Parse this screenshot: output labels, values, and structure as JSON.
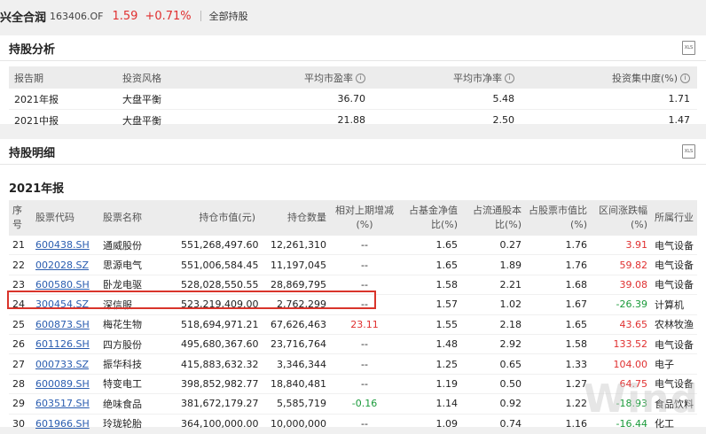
{
  "header": {
    "fund_name": "兴全合润",
    "fund_code": "163406.OF",
    "price": "1.59",
    "change": "+0.71%",
    "all_holdings": "全部持股"
  },
  "analysis": {
    "title": "持股分析",
    "export_icon": "xls-export-icon",
    "columns": [
      "报告期",
      "投资风格",
      "平均市盈率",
      "平均市净率",
      "投资集中度(%)"
    ],
    "rows": [
      [
        "2021年报",
        "大盘平衡",
        "36.70",
        "5.48",
        "1.71"
      ],
      [
        "2021中报",
        "大盘平衡",
        "21.88",
        "2.50",
        "1.47"
      ]
    ]
  },
  "detail": {
    "title": "持股明细",
    "export_icon": "xls-export-icon",
    "year": "2021年报",
    "columns": [
      "序号",
      "股票代码",
      "股票名称",
      "持仓市值(元)",
      "持仓数量",
      "相对上期增减(%)",
      "占基金净值比(%)",
      "占流通股本比(%)",
      "占股票市值比(%)",
      "区间涨跌幅(%)",
      "所属行业"
    ],
    "rows": [
      {
        "no": "21",
        "code": "600438.SH",
        "name": "通威股份",
        "value": "551,268,497.60",
        "qty": "12,261,310",
        "chg": "--",
        "nav": "1.65",
        "float": "0.27",
        "mkt": "1.76",
        "ret": "3.91",
        "industry": "电气设备"
      },
      {
        "no": "22",
        "code": "002028.SZ",
        "name": "思源电气",
        "value": "551,006,584.45",
        "qty": "11,197,045",
        "chg": "--",
        "nav": "1.65",
        "float": "1.89",
        "mkt": "1.76",
        "ret": "59.82",
        "industry": "电气设备"
      },
      {
        "no": "23",
        "code": "600580.SH",
        "name": "卧龙电驱",
        "value": "528,028,550.55",
        "qty": "28,869,795",
        "chg": "--",
        "nav": "1.58",
        "float": "2.21",
        "mkt": "1.68",
        "ret": "39.08",
        "industry": "电气设备"
      },
      {
        "no": "24",
        "code": "300454.SZ",
        "name": "深信服",
        "value": "523,219,409.00",
        "qty": "2,762,299",
        "chg": "--",
        "nav": "1.57",
        "float": "1.02",
        "mkt": "1.67",
        "ret": "-26.39",
        "industry": "计算机"
      },
      {
        "no": "25",
        "code": "600873.SH",
        "name": "梅花生物",
        "value": "518,694,971.21",
        "qty": "67,626,463",
        "chg": "23.11",
        "nav": "1.55",
        "float": "2.18",
        "mkt": "1.65",
        "ret": "43.65",
        "industry": "农林牧渔"
      },
      {
        "no": "26",
        "code": "601126.SH",
        "name": "四方股份",
        "value": "495,680,367.60",
        "qty": "23,716,764",
        "chg": "--",
        "nav": "1.48",
        "float": "2.92",
        "mkt": "1.58",
        "ret": "133.52",
        "industry": "电气设备"
      },
      {
        "no": "27",
        "code": "000733.SZ",
        "name": "振华科技",
        "value": "415,883,632.32",
        "qty": "3,346,344",
        "chg": "--",
        "nav": "1.25",
        "float": "0.65",
        "mkt": "1.33",
        "ret": "104.00",
        "industry": "电子"
      },
      {
        "no": "28",
        "code": "600089.SH",
        "name": "特变电工",
        "value": "398,852,982.77",
        "qty": "18,840,481",
        "chg": "--",
        "nav": "1.19",
        "float": "0.50",
        "mkt": "1.27",
        "ret": "64.75",
        "industry": "电气设备"
      },
      {
        "no": "29",
        "code": "603517.SH",
        "name": "绝味食品",
        "value": "381,672,179.27",
        "qty": "5,585,719",
        "chg": "-0.16",
        "nav": "1.14",
        "float": "0.92",
        "mkt": "1.22",
        "ret": "-18.93",
        "industry": "食品饮料"
      },
      {
        "no": "30",
        "code": "601966.SH",
        "name": "玲珑轮胎",
        "value": "364,100,000.00",
        "qty": "10,000,000",
        "chg": "--",
        "nav": "1.09",
        "float": "0.74",
        "mkt": "1.16",
        "ret": "-16.44",
        "industry": "化工"
      }
    ]
  },
  "watermark": "Wind",
  "colors": {
    "up": "#e03030",
    "down": "#1a9a3a",
    "link": "#2a5db0",
    "highlight": "#d9342b"
  }
}
